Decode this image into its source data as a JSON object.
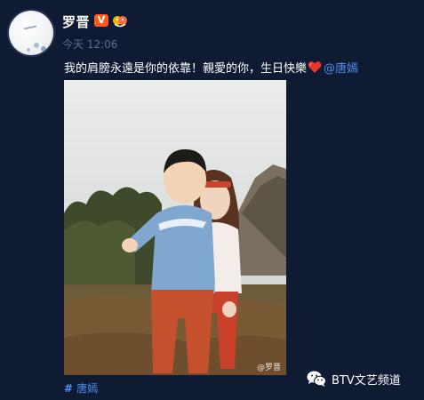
{
  "user": {
    "name": "罗晋",
    "verified_mark": "V",
    "avatar_icon": "avatar-icon"
  },
  "post": {
    "timestamp": "今天 12:06",
    "text": "我的肩膀永遠是你的依靠！親愛的你，生日快樂",
    "mention": "@唐嫣",
    "heart_icon": "heart-icon",
    "photo_watermark": "@罗晋"
  },
  "topic": {
    "hash": "#",
    "label": "唐嫣"
  },
  "channel_watermark": {
    "icon": "wechat-icon",
    "label": "BTV文艺频道"
  },
  "colors": {
    "background": "#0f1a33",
    "link": "#4f8ff0",
    "verified": "#ff5a1f",
    "timestamp": "#5e6d8f"
  }
}
